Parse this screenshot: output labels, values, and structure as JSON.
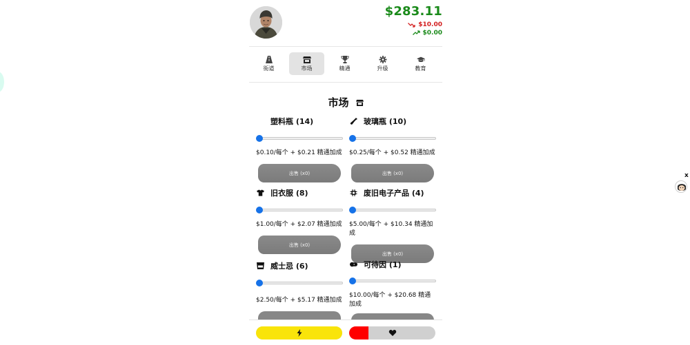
{
  "header": {
    "total": "$283.11",
    "change_down": "$10.00",
    "change_up": "$0.00"
  },
  "nav": [
    {
      "label": "街道",
      "icon": "road-icon",
      "active": false
    },
    {
      "label": "市场",
      "icon": "store-icon",
      "active": true
    },
    {
      "label": "精通",
      "icon": "trophy-icon",
      "active": false
    },
    {
      "label": "升级",
      "icon": "gear-icon",
      "active": false
    },
    {
      "label": "教育",
      "icon": "graduation-cap-icon",
      "active": false
    }
  ],
  "market": {
    "title": "市场",
    "items": [
      {
        "name": "塑料瓶 (14)",
        "icon": "none",
        "price": "$0.10/每个 + $0.21 精通加成",
        "sell": "出售 (x0)",
        "slider_value": 0
      },
      {
        "name": "玻璃瓶 (10)",
        "icon": "bottle-icon",
        "price": "$0.25/每个 + $0.52 精通加成",
        "sell": "出售 (x0)",
        "slider_value": 0
      },
      {
        "name": "旧衣服 (8)",
        "icon": "shirt-icon",
        "price": "$1.00/每个 + $2.07 精通加成",
        "sell": "出售 (x0)",
        "slider_value": 0
      },
      {
        "name": "废旧电子产品 (4)",
        "icon": "chip-icon",
        "price": "$5.00/每个 + $10.34 精通加成",
        "sell": "出售 (x0)",
        "slider_value": 0
      },
      {
        "name": "威士忌 (6)",
        "icon": "glass-icon",
        "price": "$2.50/每个 + $5.17 精通加成",
        "sell": "",
        "slider_value": 0
      },
      {
        "name": "可待因 (1)",
        "icon": "pill-icon",
        "price": "$10.00/每个 + $20.68 精通加成",
        "sell": "",
        "slider_value": 0
      }
    ]
  },
  "status": {
    "energy_fraction": 1.0,
    "health_fraction": 0.22,
    "energy_color": "#f9e40a",
    "health_color": "#ff0000"
  },
  "side": {
    "close_label": "x"
  }
}
